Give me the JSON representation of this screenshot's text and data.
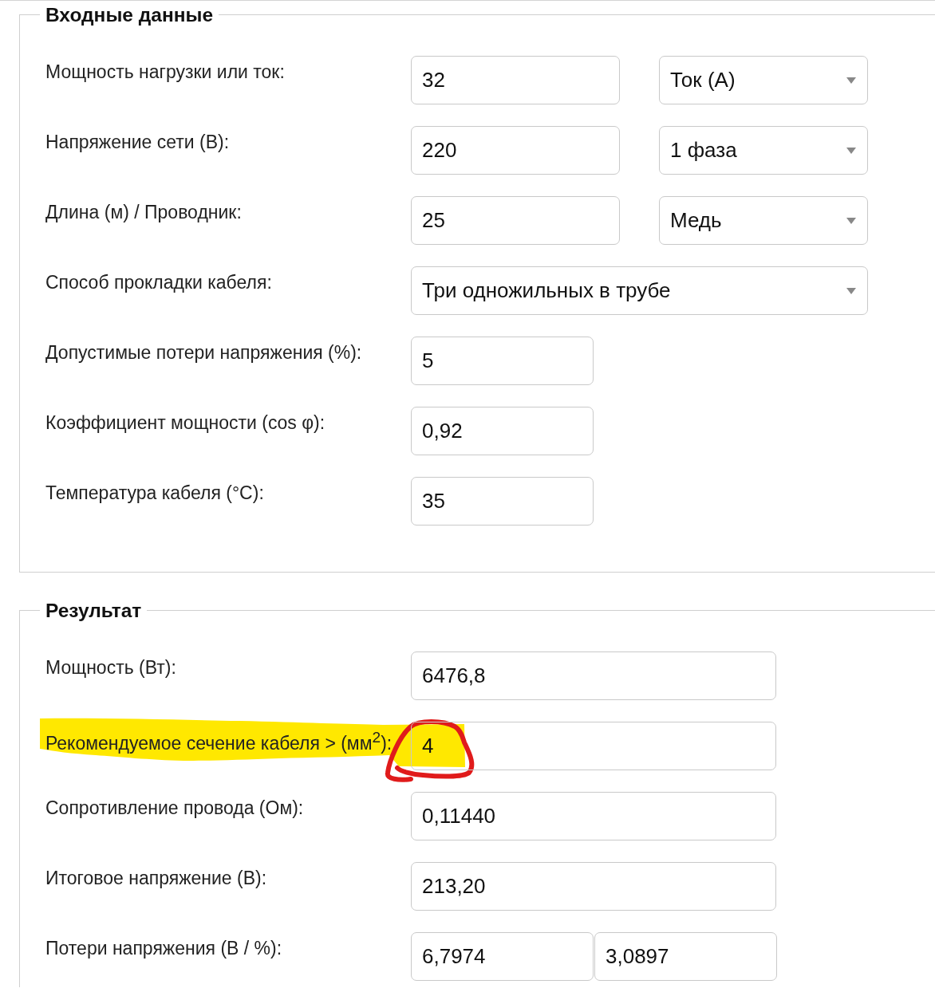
{
  "sections": [
    {
      "kind": "inputs",
      "title": "Входные данные",
      "rows": [
        {
          "label": "Мощность нагрузки или ток:",
          "controls": [
            {
              "kind": "input",
              "value": "32"
            },
            {
              "kind": "select",
              "value": "Ток (А)"
            }
          ]
        },
        {
          "label": "Напряжение сети (В):",
          "controls": [
            {
              "kind": "input",
              "value": "220"
            },
            {
              "kind": "select",
              "value": "1 фаза"
            }
          ]
        },
        {
          "label": "Длина (м) / Проводник:",
          "controls": [
            {
              "kind": "input",
              "value": "25"
            },
            {
              "kind": "select",
              "value": "Медь"
            }
          ]
        },
        {
          "label": "Способ прокладки кабеля:",
          "controls": [
            {
              "kind": "select",
              "value": "Три одножильных в трубе"
            }
          ]
        },
        {
          "label": "Допустимые потери напряжения (%):",
          "controls": [
            {
              "kind": "input",
              "value": "5"
            }
          ]
        },
        {
          "label": "Коэффициент мощности (cos φ):",
          "controls": [
            {
              "kind": "input",
              "value": "0,92"
            }
          ]
        },
        {
          "label": "Температура кабеля (°C):",
          "controls": [
            {
              "kind": "input",
              "value": "35"
            }
          ]
        }
      ]
    },
    {
      "kind": "results",
      "title": "Результат",
      "rows": [
        {
          "label": "Мощность (Вт):",
          "highlighted": false,
          "circled": false,
          "controls": [
            {
              "kind": "input",
              "value": "6476,8"
            }
          ]
        },
        {
          "label": "Рекомендуемое сечение кабеля > (мм$^{2}$):",
          "highlighted": true,
          "circled": true,
          "controls": [
            {
              "kind": "input",
              "value": "4"
            }
          ]
        },
        {
          "label": "Сопротивление провода (Ом):",
          "highlighted": false,
          "circled": false,
          "controls": [
            {
              "kind": "input",
              "value": "0,11440"
            }
          ]
        },
        {
          "label": "Итоговое напряжение (В):",
          "highlighted": false,
          "circled": false,
          "controls": [
            {
              "kind": "input",
              "value": "213,20"
            }
          ]
        },
        {
          "label": "Потери напряжения (В / %):",
          "highlighted": false,
          "circled": false,
          "controls": [
            {
              "kind": "input",
              "value": "6,7974"
            },
            {
              "kind": "input",
              "value": "3,0897"
            }
          ]
        }
      ]
    }
  ]
}
